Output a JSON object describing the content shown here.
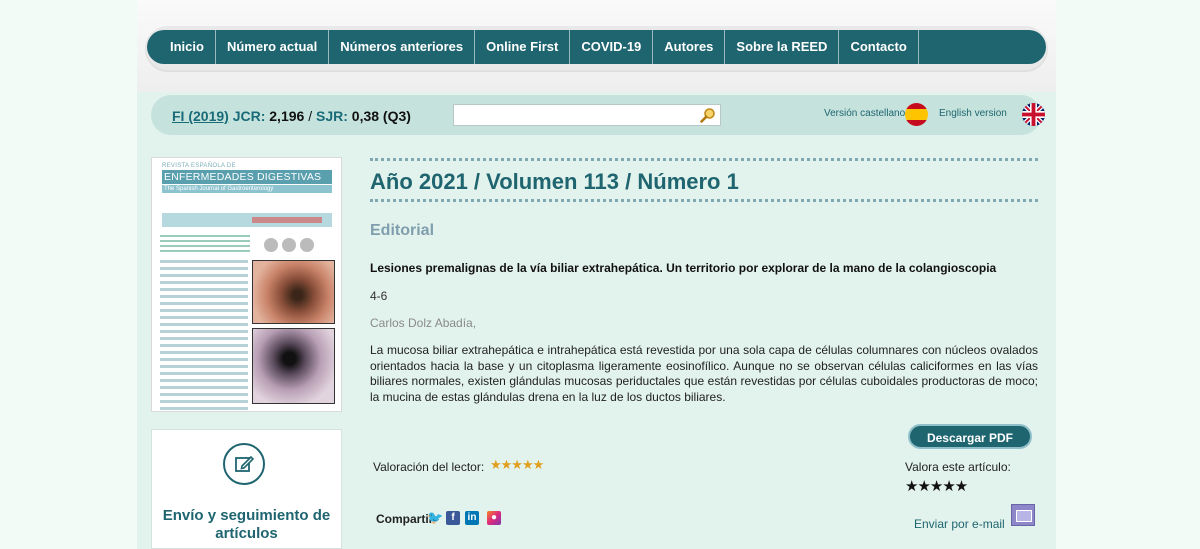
{
  "nav": {
    "items": [
      "Inicio",
      "Número actual",
      "Números anteriores",
      "Online First",
      "COVID-19",
      "Autores",
      "Sobre la REED",
      "Contacto"
    ]
  },
  "metrics": {
    "fi": "FI (2019)",
    "jcr_label": "JCR:",
    "jcr_value": "2,196",
    "sjr_label": "SJR:",
    "sjr_value": "0,38 (Q3)"
  },
  "search": {
    "value": "",
    "icon": "magnifier-icon"
  },
  "languages": {
    "spanish": "Versión castellano",
    "english": "English version"
  },
  "cover": {
    "line1": "REVISTA ESPAÑOLA DE",
    "line2": "ENFERMEDADES DIGESTIVAS",
    "line3": "The Spanish Journal of Gastroenterology"
  },
  "envio": {
    "title": "Envío y seguimiento de artículos",
    "icon": "edit-icon"
  },
  "issue": {
    "title": "Año 2021 / Volumen 113 / Número 1"
  },
  "article": {
    "section": "Editorial",
    "title": "Lesiones premalignas de la vía biliar extrahepática. Un territorio por explorar de la mano de la colangioscopia",
    "pages": "4-6",
    "authors": "Carlos Dolz Abadía,",
    "abstract": "La mucosa biliar extrahepática e intrahepática está revestida por una sola capa de células columnares con núcleos ovalados orientados hacia la base y un citoplasma ligeramente eosinofílico. Aunque no se observan células caliciformes en las vías biliares normales, existen glándulas mucosas periductales que están revestidas por células cuboidales productoras de moco; la mucina de estas glándulas drena en la luz de los ductos biliares."
  },
  "actions": {
    "download_pdf": "Descargar PDF",
    "reader_rating_label": "Valoración del lector:",
    "reader_rating": 4.5,
    "reader_rating_stars": "★★★★★",
    "rate_label": "Valora este artículo:",
    "rate_stars": "★★★★★",
    "share_label": "Compartir",
    "email_label": "Enviar por e-mail"
  },
  "colors": {
    "primary": "#1f6570",
    "page_bg": "#e2f2ec",
    "info_bar": "#c5e3dc",
    "star_gold": "#e0a01e"
  }
}
